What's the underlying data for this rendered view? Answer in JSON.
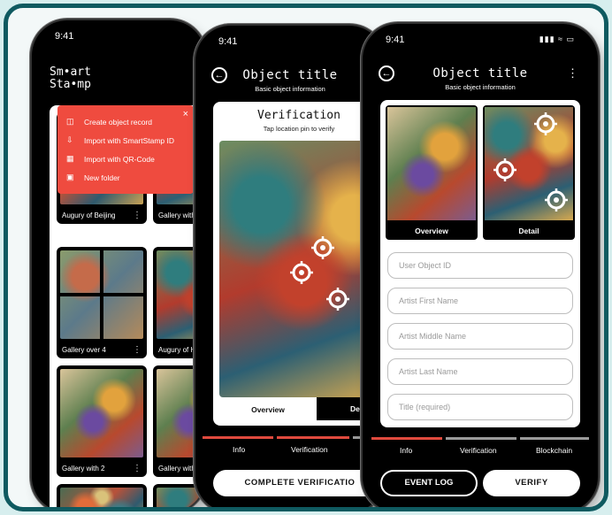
{
  "phone1": {
    "time": "9:41",
    "logo_line1": "Sm•art",
    "logo_line2": "Sta•mp",
    "menu": {
      "items": [
        {
          "icon": "create-record-icon",
          "label": "Create object record"
        },
        {
          "icon": "import-id-icon",
          "label": "Import with SmartStamp ID"
        },
        {
          "icon": "qr-code-icon",
          "label": "Import with QR-Code"
        },
        {
          "icon": "new-folder-icon",
          "label": "New folder"
        }
      ],
      "close": "×"
    },
    "cards": [
      {
        "label": "Augury of Beijing"
      },
      {
        "label": "Gallery with"
      },
      {
        "label": "Gallery over 4"
      },
      {
        "label": "Augury of H"
      },
      {
        "label": "Gallery with 2"
      },
      {
        "label": "Gallery with"
      }
    ]
  },
  "phone2": {
    "time": "9:41",
    "title": "Object title",
    "subtitle": "Basic object information",
    "panel_title": "Verification",
    "panel_subtitle": "Tap location pin to verify",
    "tab_overview": "Overview",
    "tab_detail": "Det",
    "tabs": [
      "Info",
      "Verification"
    ],
    "button": "COMPLETE VERIFICATIO"
  },
  "phone3": {
    "time": "9:41",
    "title": "Object title",
    "subtitle": "Basic object information",
    "thumbs": [
      "Overview",
      "Detail"
    ],
    "fields": [
      "User Object ID",
      "Artist First Name",
      "Artist Middle Name",
      "Artist Last Name",
      "Title (required)"
    ],
    "tabs": [
      "Info",
      "Verification",
      "Blockchain"
    ],
    "event_log": "EVENT LOG",
    "verify": "VERIFY"
  },
  "colors": {
    "frame": "#0f5a60",
    "menu": "#ef4b3f",
    "active_tab": "#e04a3e",
    "inactive_tab": "#9a9a9a"
  }
}
